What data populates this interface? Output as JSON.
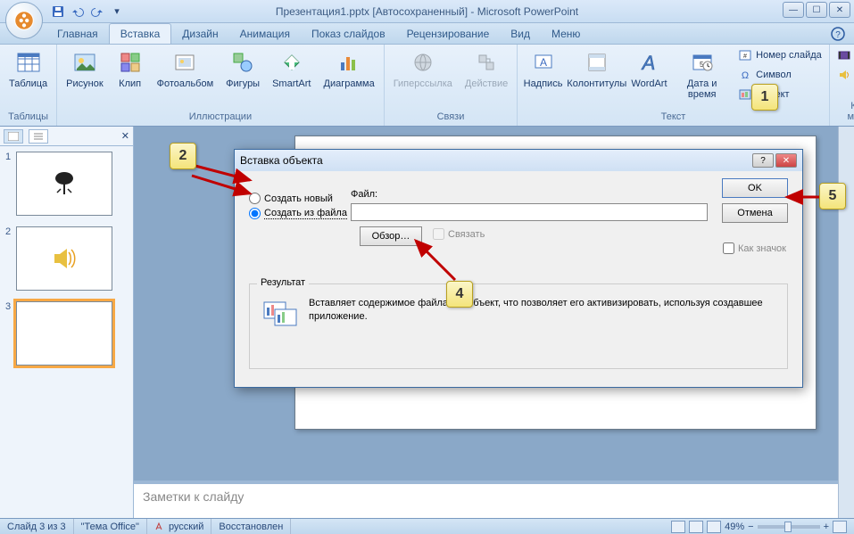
{
  "title": "Презентация1.pptx [Автосохраненный] - Microsoft PowerPoint",
  "tabs": {
    "home": "Главная",
    "insert": "Вставка",
    "design": "Дизайн",
    "animation": "Анимация",
    "slideshow": "Показ слайдов",
    "review": "Рецензирование",
    "view": "Вид",
    "menu": "Меню"
  },
  "ribbon": {
    "tables": {
      "label": "Таблицы",
      "table": "Таблица"
    },
    "illustrations": {
      "label": "Иллюстрации",
      "picture": "Рисунок",
      "clip": "Клип",
      "album": "Фотоальбом",
      "shapes": "Фигуры",
      "smartart": "SmartArt",
      "chart": "Диаграмма"
    },
    "links": {
      "label": "Связи",
      "hyperlink": "Гиперссылка",
      "action": "Действие"
    },
    "text": {
      "label": "Текст",
      "textbox": "Надпись",
      "headerfooter": "Колонтитулы",
      "wordart": "WordArt",
      "datetime": "Дата и время",
      "slidenum": "Номер слайда",
      "symbol": "Символ",
      "object": "Объект"
    },
    "media": {
      "label": "Клипы мульт…",
      "movie": "Фильм",
      "sound": "Звук"
    }
  },
  "slides": {
    "n1": "1",
    "n2": "2",
    "n3": "3"
  },
  "notes_placeholder": "Заметки к слайду",
  "statusbar": {
    "slide": "Слайд 3 из 3",
    "theme": "\"Тема Office\"",
    "lang": "русский",
    "recovered": "Восстановлен",
    "zoom": "49%"
  },
  "dialog": {
    "title": "Вставка объекта",
    "create_new": "Создать новый",
    "create_from_file": "Создать из файла",
    "file_label": "Файл:",
    "browse": "Обзор…",
    "link": "Связать",
    "as_icon": "Как значок",
    "ok": "OK",
    "cancel": "Отмена",
    "result_label": "Результат",
    "result_text": "Вставляет содержимое файла как объект, что позволяет его активизировать, используя создавшее приложение."
  },
  "callouts": {
    "c1": "1",
    "c2": "2",
    "c4": "4",
    "c5": "5"
  }
}
